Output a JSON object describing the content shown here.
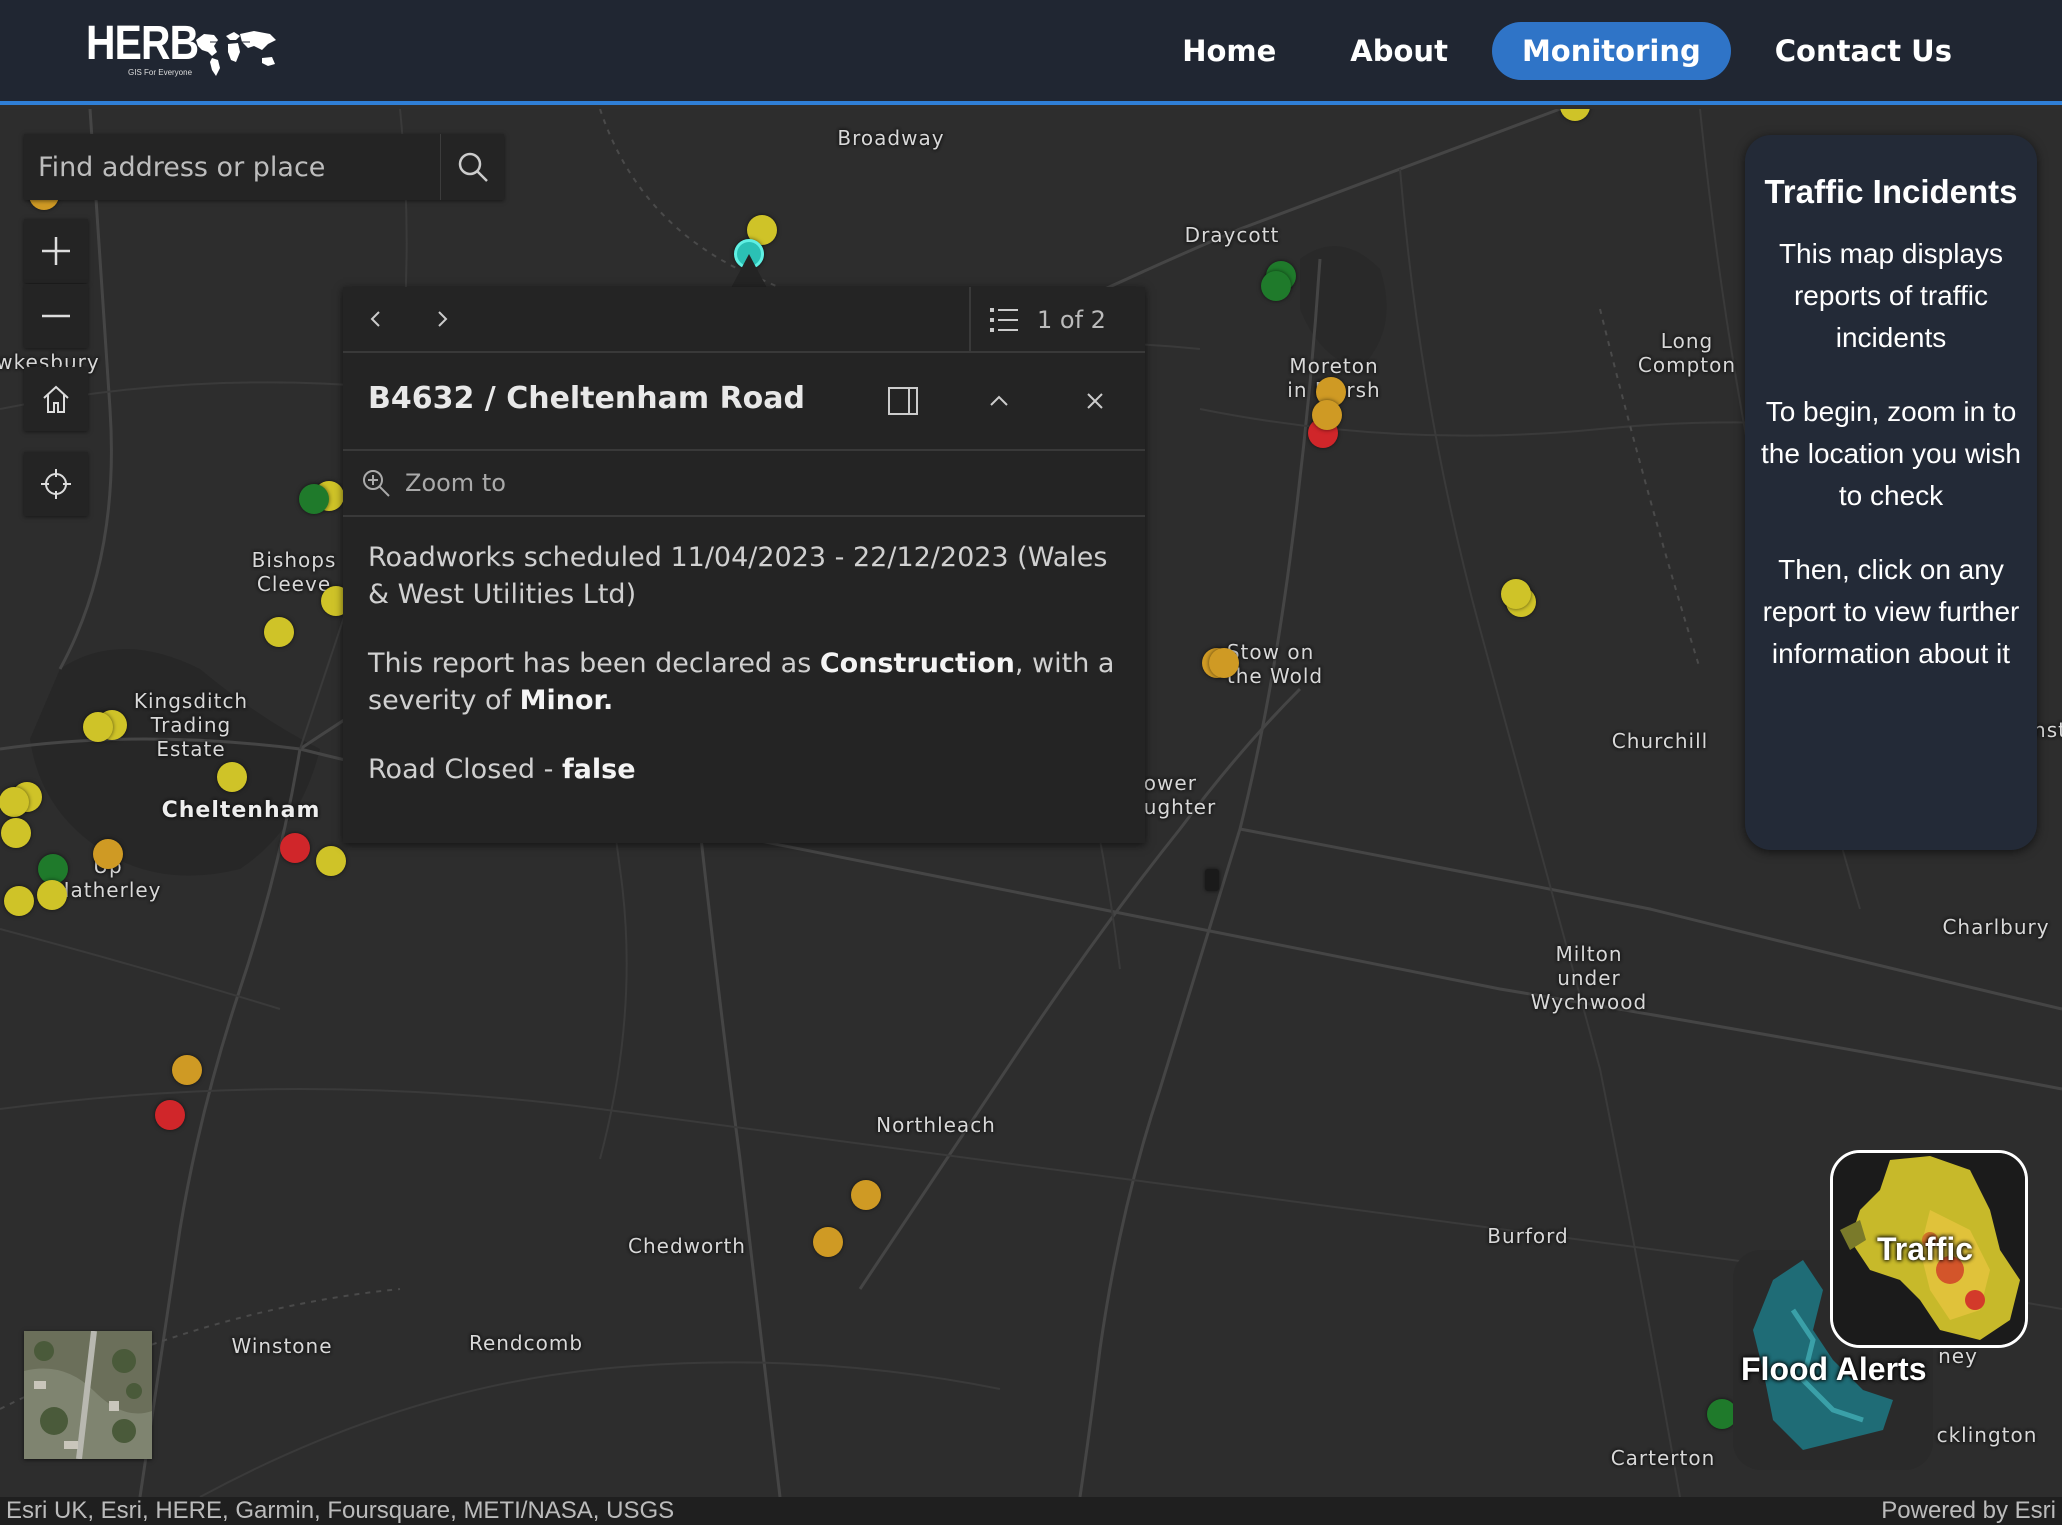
{
  "brand": {
    "name": "HERB",
    "tagline": "GIS For Everyone"
  },
  "nav": [
    {
      "label": "Home",
      "active": false
    },
    {
      "label": "About",
      "active": false
    },
    {
      "label": "Monitoring",
      "active": true
    },
    {
      "label": "Contact Us",
      "active": false
    }
  ],
  "search": {
    "placeholder": "Find address or place"
  },
  "places": [
    {
      "name": "Broadway"
    },
    {
      "name": "Draycott"
    },
    {
      "name": "Long\nCompton"
    },
    {
      "name": "Moreton\nin Marsh"
    },
    {
      "name": "wkesbury"
    },
    {
      "name": "Bishops\nCleeve"
    },
    {
      "name": "Kingsditch\nTrading\nEstate"
    },
    {
      "name": "Cheltenham"
    },
    {
      "name": "Up\nHatherley"
    },
    {
      "name": "Stow on\nthe Wold"
    },
    {
      "name": "Churchill"
    },
    {
      "name": "ower\nughter"
    },
    {
      "name": "Charlbury"
    },
    {
      "name": "Milton\nunder\nWychwood"
    },
    {
      "name": "Northleach"
    },
    {
      "name": "Chedworth"
    },
    {
      "name": "Burford"
    },
    {
      "name": "Winstone"
    },
    {
      "name": "Rendcomb"
    },
    {
      "name": "Carterton"
    },
    {
      "name": "ney"
    },
    {
      "name": "cklington"
    },
    {
      "name": "nst"
    }
  ],
  "marker_colors": {
    "green": "#1f7a2b",
    "yellow": "#cfc328",
    "amber": "#cf9a24",
    "red": "#d0262a",
    "selected": "#2bc1b5"
  },
  "popup": {
    "feature_count": "1 of 2",
    "title": "B4632 / Cheltenham Road",
    "zoom_label": "Zoom to",
    "description": "Roadworks scheduled 11/04/2023 - 22/12/2023 (Wales & West Utilities Ltd)",
    "declared_prefix": "This report has been declared as ",
    "category": "Construction",
    "severity_prefix": ", with a severity of ",
    "severity": "Minor.",
    "road_closed_label": "Road Closed - ",
    "road_closed_value": "false"
  },
  "info_panel": {
    "title": "Traffic Incidents",
    "paragraphs": [
      "This map displays reports of traffic incidents",
      "To begin, zoom in to the location you wish to check",
      "Then, click on any report to view further information about it"
    ]
  },
  "layer_cards": [
    {
      "label": "Traffic",
      "selected": true
    },
    {
      "label": "Flood Alerts",
      "selected": false
    }
  ],
  "attribution": {
    "left": "Esri UK, Esri, HERE, Garmin, Foursquare, METI/NASA, USGS",
    "right": "Powered by Esri"
  }
}
